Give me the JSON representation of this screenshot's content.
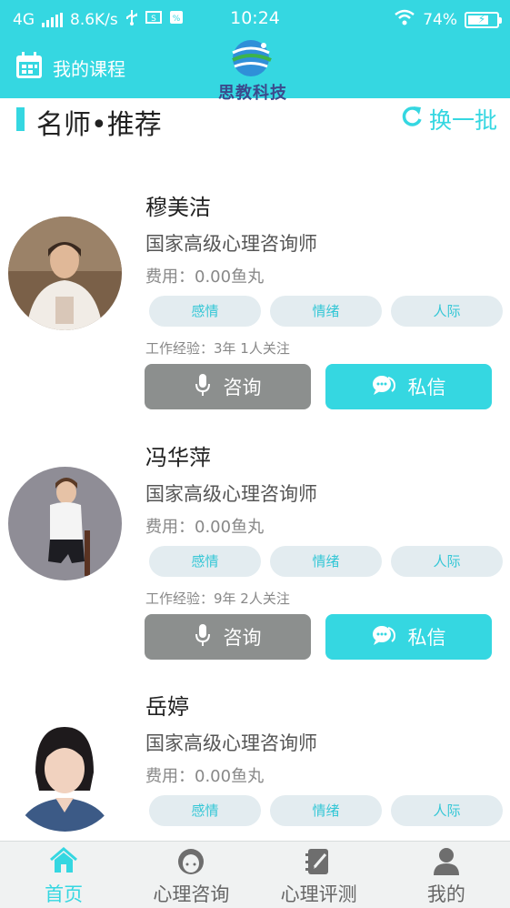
{
  "status_bar": {
    "network": "4G",
    "speed": "8.6K/s",
    "time": "10:24",
    "battery_text": "74%",
    "battery_level": 0.74
  },
  "header": {
    "my_course_label": "我的课程",
    "logo_text": "思教科技"
  },
  "section": {
    "title": "名师•推荐",
    "refresh_label": "换一批"
  },
  "teachers": [
    {
      "name": "穆美洁",
      "title": "国家高级心理咨询师",
      "fee": "费用：0.00鱼丸",
      "tags": [
        "感情",
        "情绪",
        "人际"
      ],
      "experience": "工作经验：3年   1人关注",
      "consult_label": "咨询",
      "message_label": "私信"
    },
    {
      "name": "冯华萍",
      "title": "国家高级心理咨询师",
      "fee": "费用：0.00鱼丸",
      "tags": [
        "感情",
        "情绪",
        "人际"
      ],
      "experience": "工作经验：9年   2人关注",
      "consult_label": "咨询",
      "message_label": "私信"
    },
    {
      "name": "岳婷",
      "title": "国家高级心理咨询师",
      "fee": "费用：0.00鱼丸",
      "tags": [
        "感情",
        "情绪",
        "人际"
      ]
    }
  ],
  "tabbar": {
    "items": [
      {
        "label": "首页",
        "icon": "home-icon",
        "active": true
      },
      {
        "label": "心理咨询",
        "icon": "counselor-icon",
        "active": false
      },
      {
        "label": "心理评测",
        "icon": "assessment-icon",
        "active": false
      },
      {
        "label": "我的",
        "icon": "user-icon",
        "active": false
      }
    ]
  },
  "colors": {
    "accent": "#35d7e1",
    "consult_button": "#8c8f8e",
    "tag_bg": "#e3ecf0"
  }
}
